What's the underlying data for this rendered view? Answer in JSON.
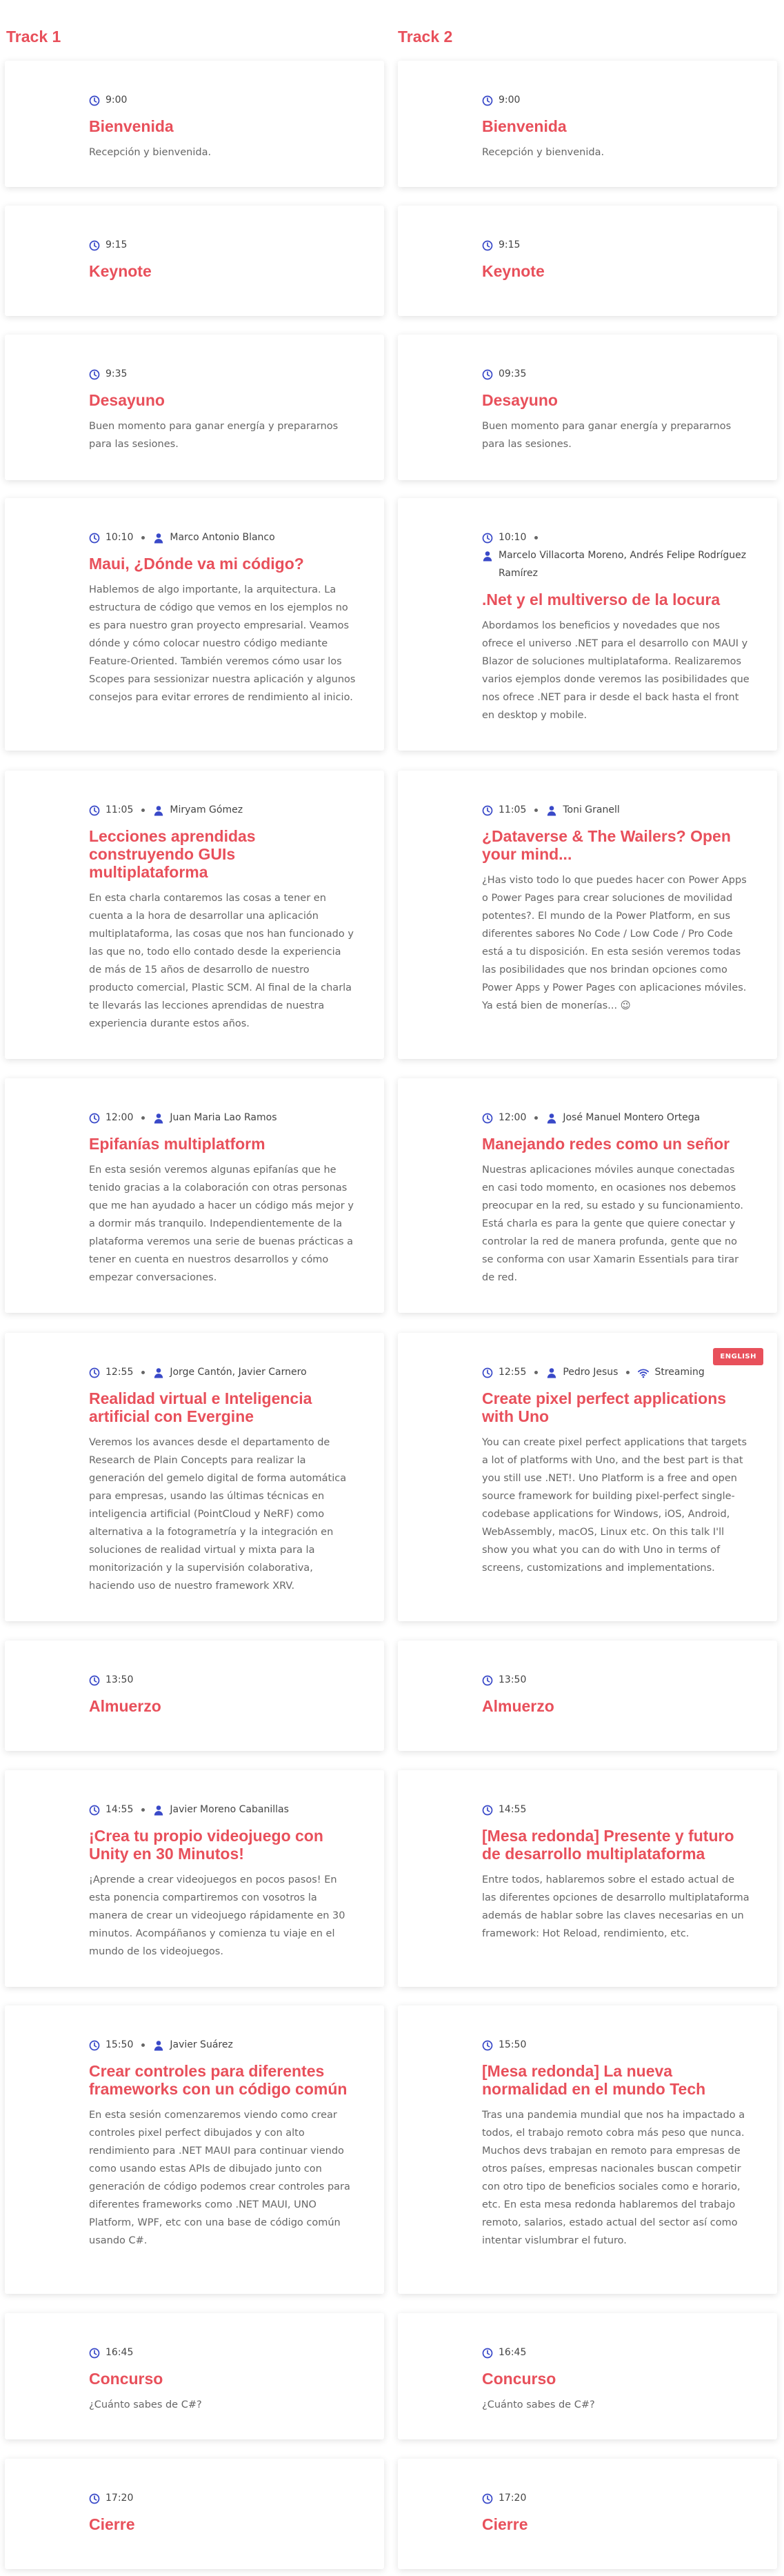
{
  "tracks": [
    {
      "title": "Track 1"
    },
    {
      "title": "Track 2"
    }
  ],
  "colors": {
    "accent": "#e8505b",
    "icon": "#3949c8"
  },
  "icons": {
    "time": "clock-icon",
    "speaker": "user-icon",
    "stream": "wifi-icon"
  },
  "rows": [
    {
      "t1": {
        "time": "9:00",
        "speakers": "",
        "title": "Bienvenida",
        "description": "Recepción y bienvenida."
      },
      "t2": {
        "time": "9:00",
        "speakers": "",
        "title": "Bienvenida",
        "description": "Recepción y bienvenida."
      }
    },
    {
      "t1": {
        "time": "9:15",
        "speakers": "",
        "title": "Keynote",
        "description": ""
      },
      "t2": {
        "time": "9:15",
        "speakers": "",
        "title": "Keynote",
        "description": ""
      }
    },
    {
      "t1": {
        "time": "9:35",
        "speakers": "",
        "title": "Desayuno",
        "description": "Buen momento para ganar energía y prepararnos para las sesiones."
      },
      "t2": {
        "time": "09:35",
        "speakers": "",
        "title": "Desayuno",
        "description": "Buen momento para ganar energía y prepararnos para las sesiones."
      }
    },
    {
      "t1": {
        "time": "10:10",
        "speakers": "Marco Antonio Blanco",
        "title": "Maui, ¿Dónde va mi código?",
        "description": "Hablemos de algo importante, la arquitectura. La estructura de código que vemos en los ejemplos no es para nuestro gran proyecto empresarial. Veamos dónde y cómo colocar nuestro código mediante Feature-Oriented. También veremos cómo usar los Scopes para sessionizar nuestra aplicación y algunos consejos para evitar errores de rendimiento al inicio."
      },
      "t2": {
        "time": "10:10",
        "speakers": "Marcelo Villacorta Moreno, Andrés Felipe Rodríguez Ramírez",
        "title": ".Net y el multiverso de la locura",
        "description": "Abordamos los beneficios y novedades que nos ofrece el universo .NET para el desarrollo con MAUI y Blazor de soluciones multiplataforma. Realizaremos varios ejemplos donde veremos las posibilidades que nos ofrece .NET para ir desde el back hasta el front en desktop y mobile."
      }
    },
    {
      "t1": {
        "time": "11:05",
        "speakers": "Miryam Gómez",
        "title": "Lecciones aprendidas construyendo GUIs multiplataforma",
        "description": "En esta charla contaremos las cosas a tener en cuenta a la hora de desarrollar una aplicación multiplataforma, las cosas que nos han funcionado y las que no, todo ello contado desde la experiencia de más de 15 años de desarrollo de nuestro producto comercial, Plastic SCM. Al final de la charla te llevarás las lecciones aprendidas de nuestra experiencia durante estos años."
      },
      "t2": {
        "time": "11:05",
        "speakers": "Toni Granell",
        "title": "¿Dataverse & The Wailers? Open your mind...",
        "description": "¿Has visto todo lo que puedes hacer con Power Apps o Power Pages para crear soluciones de movilidad potentes?. El mundo de la Power Platform, en sus diferentes sabores No Code / Low Code / Pro Code está a tu disposición. En esta sesión veremos todas las posibilidades que nos brindan opciones como Power Apps y Power Pages con aplicaciones móviles. Ya está bien de monerías... 😉"
      }
    },
    {
      "t1": {
        "time": "12:00",
        "speakers": "Juan Maria Lao Ramos",
        "title": "Epifanías multiplatform",
        "description": "En esta sesión veremos algunas epifanías que he tenido gracias a la colaboración con otras personas que me han ayudado a hacer un código más mejor y a dormir más tranquilo. Independientemente de la plataforma veremos una serie de buenas prácticas a tener en cuenta en nuestros desarrollos y cómo empezar conversaciones."
      },
      "t2": {
        "time": "12:00",
        "speakers": "José Manuel Montero Ortega",
        "title": "Manejando redes como un señor",
        "description": "Nuestras aplicaciones móviles aunque conectadas en casi todo momento, en ocasiones nos debemos preocupar en la red, su estado y su funcionamiento. Está charla es para la gente que quiere conectar y controlar la red de manera profunda, gente que no se conforma con usar Xamarin Essentials para tirar de red."
      }
    },
    {
      "t1": {
        "time": "12:55",
        "speakers": "Jorge Cantón, Javier Carnero",
        "title": "Realidad virtual e Inteligencia artificial con Evergine",
        "description": "Veremos los avances desde el departamento de Research de Plain Concepts para realizar la generación del gemelo digital de forma automática para empresas, usando las últimas técnicas en inteligencia artificial (PointCloud y NeRF) como alternativa a la fotogrametría y la integración en soluciones de realidad virtual y mixta para la monitorización y la supervisión colaborativa, haciendo uso de nuestro framework XRV."
      },
      "t2": {
        "time": "12:55",
        "speakers": "Pedro Jesus",
        "stream": "Streaming",
        "badge": "ENGLISH",
        "title": "Create pixel perfect applications with Uno",
        "description": "You can create pixel perfect applications that targets a lot of platforms with Uno, and the best part is that you still use .NET!. Uno Platform is a free and open source framework for building pixel-perfect single-codebase applications for Windows, iOS, Android, WebAssembly, macOS, Linux etc. On this talk I'll show you what you can do with Uno in terms of screens, customizations and implementations."
      }
    },
    {
      "t1": {
        "time": "13:50",
        "speakers": "",
        "title": "Almuerzo",
        "description": ""
      },
      "t2": {
        "time": "13:50",
        "speakers": "",
        "title": "Almuerzo",
        "description": ""
      }
    },
    {
      "t1": {
        "time": "14:55",
        "speakers": "Javier Moreno Cabanillas",
        "title": "¡Crea tu propio videojuego con Unity en 30 Minutos!",
        "description": "¡Aprende a crear videojuegos en pocos pasos! En esta ponencia compartiremos con vosotros la manera de crear un videojuego rápidamente en 30 minutos. Acompáñanos y comienza tu viaje en el mundo de los videojuegos."
      },
      "t2": {
        "time": "14:55",
        "speakers": "",
        "title": "[Mesa redonda] Presente y futuro de desarrollo multiplataforma",
        "description": "Entre todos, hablaremos sobre el estado actual de las diferentes opciones de desarrollo multiplataforma además de hablar sobre las claves necesarias en un framework: Hot Reload, rendimiento, etc."
      }
    },
    {
      "t1": {
        "time": "15:50",
        "speakers": "Javier Suárez",
        "title": "Crear controles para diferentes frameworks con un código común",
        "description": "En esta sesión comenzaremos viendo como crear controles pixel perfect dibujados y con alto rendimiento para .NET MAUI para continuar viendo como usando estas APIs de dibujado junto con generación de código podemos crear controles para diferentes frameworks como .NET MAUI, UNO Platform, WPF, etc con una base de código común usando C#."
      },
      "t2": {
        "time": "15:50",
        "speakers": "",
        "title": "[Mesa redonda] La nueva normalidad en el mundo Tech",
        "description": "Tras una pandemia mundial que nos ha impactado a todos, el trabajo remoto cobra más peso que nunca. Muchos devs trabajan en remoto para empresas de otros países, empresas nacionales buscan competir con otro tipo de beneficios sociales como e horario, etc. En esta mesa redonda hablaremos del trabajo remoto, salarios, estado actual del sector así como intentar vislumbrar el futuro."
      }
    },
    {
      "t1": {
        "time": "16:45",
        "speakers": "",
        "title": "Concurso",
        "description": "¿Cuánto sabes de C#?"
      },
      "t2": {
        "time": "16:45",
        "speakers": "",
        "title": "Concurso",
        "description": "¿Cuánto sabes de C#?"
      }
    },
    {
      "t1": {
        "time": "17:20",
        "speakers": "",
        "title": "Cierre",
        "description": ""
      },
      "t2": {
        "time": "17:20",
        "speakers": "",
        "title": "Cierre",
        "description": ""
      }
    }
  ]
}
